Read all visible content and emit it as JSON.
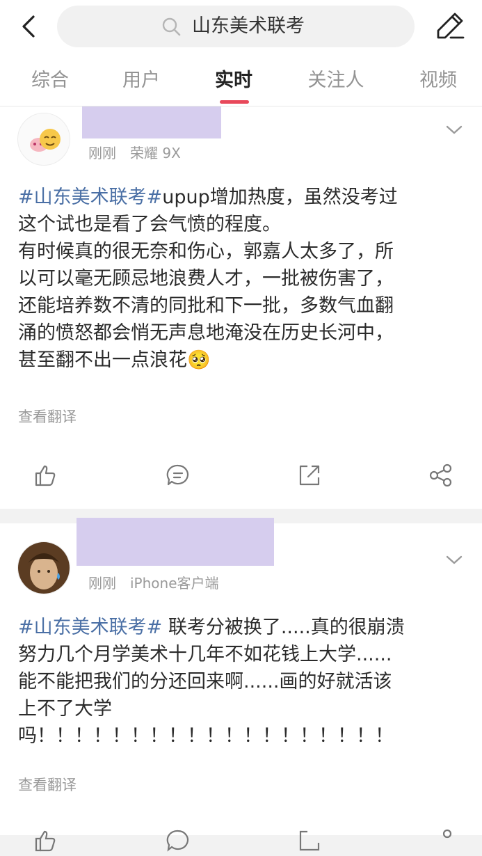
{
  "header": {
    "search_query": "山东美术联考",
    "back_icon": "chevron-left-icon",
    "edit_icon": "pencil-icon"
  },
  "tabs": [
    {
      "label": "综合"
    },
    {
      "label": "用户"
    },
    {
      "label": "实时",
      "active": true
    },
    {
      "label": "关注人"
    },
    {
      "label": "视频"
    }
  ],
  "colors": {
    "accent": "#e8485a",
    "hashtag": "#4a6fa5",
    "name_mask": "#d6cdee"
  },
  "posts": [
    {
      "time": "刚刚",
      "source": "荣耀 9X",
      "hashtag": "#山东美术联考#",
      "lines": [
        "upup增加热度，虽然没考过",
        "这个试也是看了会气愤的程度。",
        "有时候真的很无奈和伤心，郭嘉人太多了，所",
        "以可以毫无顾忌地浪费人才，一批被伤害了，",
        "还能培养数不清的同批和下一批，多数气血翻",
        "涌的愤怒都会悄无声息地淹没在历史长河中，",
        "甚至翻不出一点浪花"
      ],
      "emoji": "🥺",
      "translate_label": "查看翻译"
    },
    {
      "time": "刚刚",
      "source": "iPhone客户端",
      "hashtag": "#山东美术联考#",
      "lines": [
        " 联考分被换了.....真的很崩溃",
        "努力几个月学美术十几年不如花钱上大学......",
        "能不能把我们的分还回来啊......画的好就活该",
        "上不了大学",
        "吗！！！！！！！！！！！！！！！！！！！"
      ],
      "translate_label": "查看翻译"
    }
  ]
}
